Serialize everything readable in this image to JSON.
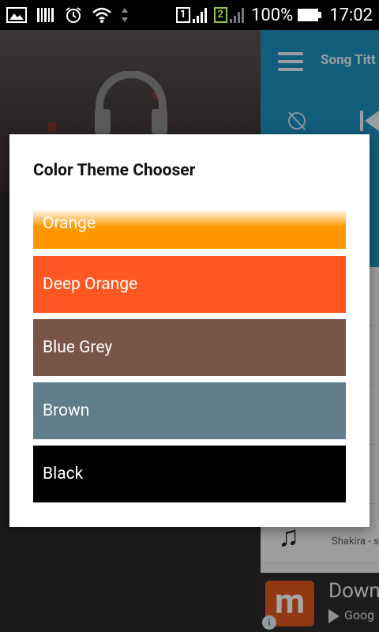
{
  "status_bar": {
    "battery": "100%",
    "time": "17:02",
    "sim1": "1",
    "sim2": "2"
  },
  "background_app": {
    "song_title": "Song Titt",
    "artist_fragment": "Shakira - s",
    "ad": {
      "logo_letter": "m",
      "title": "Down",
      "subtitle": "Goog"
    }
  },
  "dialog": {
    "title": "Color Theme Chooser",
    "options": [
      {
        "label": "Orange",
        "color": "#FF9800"
      },
      {
        "label": "Deep Orange",
        "color": "#FF5722"
      },
      {
        "label": "Blue Grey",
        "color": "#795548"
      },
      {
        "label": "Brown",
        "color": "#607D8B"
      },
      {
        "label": "Black",
        "color": "#000000"
      }
    ]
  }
}
